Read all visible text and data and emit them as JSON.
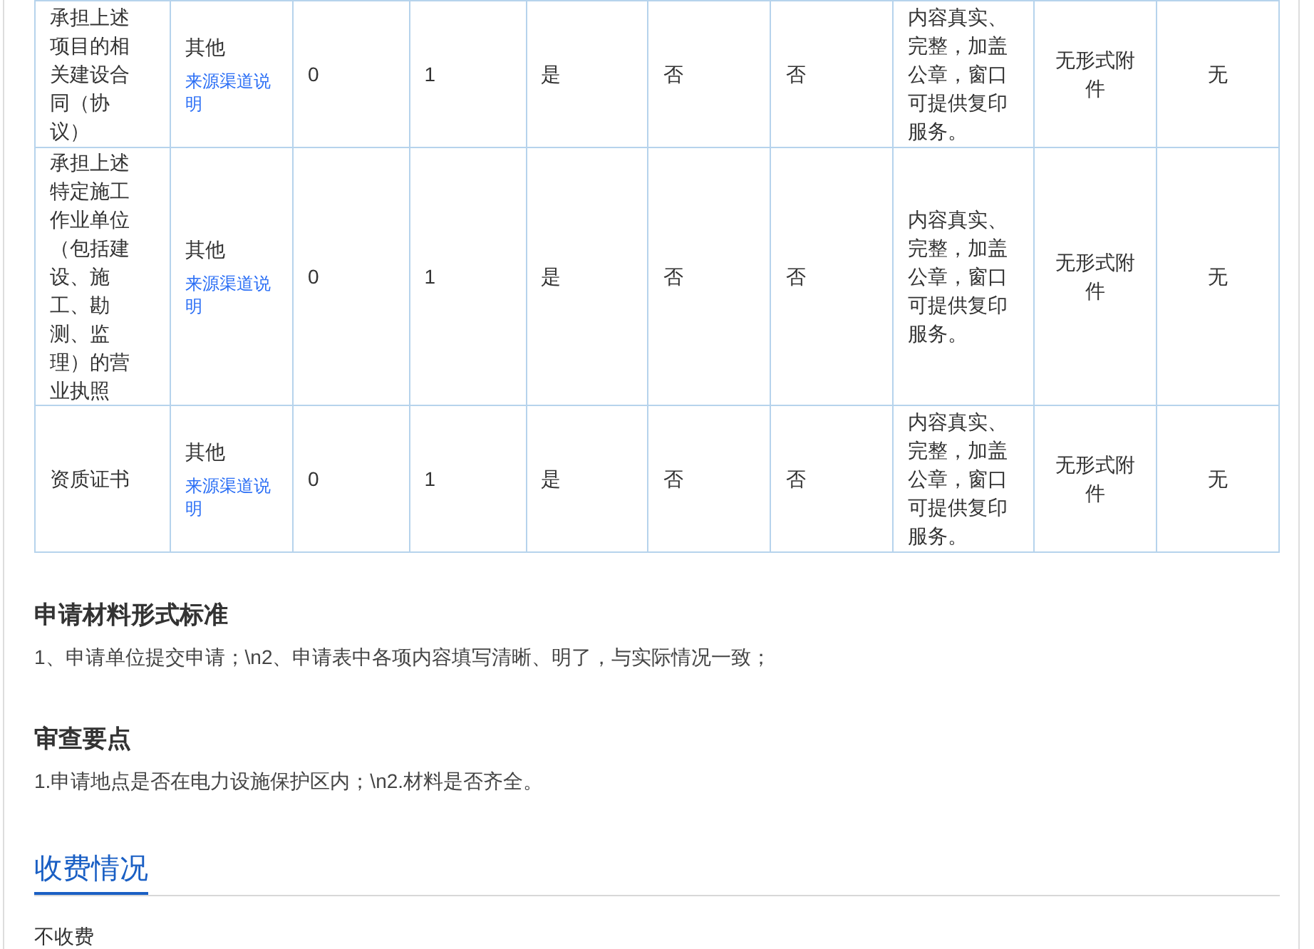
{
  "table": {
    "rows": [
      {
        "cells": [
          "承担上述项目的相关建设合同（协议）",
          "其他",
          "0",
          "1",
          "是",
          "否",
          "否",
          "内容真实、完整，加盖公章，窗口可提供复印服务。",
          "无形式附件",
          "无"
        ],
        "link": "来源渠道说明"
      },
      {
        "cells": [
          "承担上述特定施工作业单位（包括建设、施工、勘测、监理）的营业执照",
          "其他",
          "0",
          "1",
          "是",
          "否",
          "否",
          "内容真实、完整，加盖公章，窗口可提供复印服务。",
          "无形式附件",
          "无"
        ],
        "link": "来源渠道说明"
      },
      {
        "cells": [
          "资质证书",
          "其他",
          "0",
          "1",
          "是",
          "否",
          "否",
          "内容真实、完整，加盖公章，窗口可提供复印服务。",
          "无形式附件",
          "无"
        ],
        "link": "来源渠道说明"
      }
    ]
  },
  "sections": [
    {
      "title": "申请材料形式标准",
      "text": "1、申请单位提交申请；\\n2、申请表中各项内容填写清晰、明了，与实际情况一致；"
    },
    {
      "title": "审查要点",
      "text": "1.申请地点是否在电力设施保护区内；\\n2.材料是否齐全。"
    }
  ],
  "fee": {
    "tab": "收费情况",
    "selected": true,
    "text": "不收费"
  }
}
